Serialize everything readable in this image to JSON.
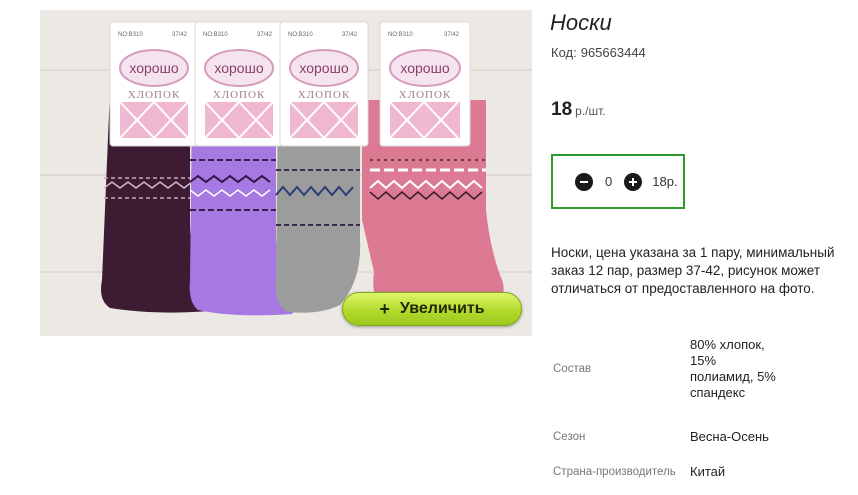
{
  "product": {
    "title": "Носки",
    "code_label": "Код:",
    "code_value": "965663444",
    "price_value": "18",
    "price_unit": "р./шт.",
    "description": "Носки, цена указана за 1 пару, минимальный заказ 12 пар, размер 37-42, рисунок может отличаться от предоставленного на фото."
  },
  "quantity": {
    "value": "0",
    "sum": "18р."
  },
  "zoom_button": {
    "icon": "plus",
    "label": "Увеличить"
  },
  "package_label": {
    "brand": "хорошо",
    "material": "ХЛОПОК",
    "article": "NO:B310",
    "size": "37/42"
  },
  "properties": [
    {
      "label": "Состав",
      "value": "80% хлопок, 15% полиамид, 5% спандекс"
    },
    {
      "label": "Сезон",
      "value": "Весна-Осень"
    },
    {
      "label": "Страна-производитель",
      "value": "Китай"
    }
  ],
  "colors": {
    "accent_green": "#2f9a2f",
    "button_lime": "#b3da2c",
    "sock_colors": [
      "#3d1c33",
      "#a679e2",
      "#9c9c9c",
      "#dd7a93"
    ]
  }
}
